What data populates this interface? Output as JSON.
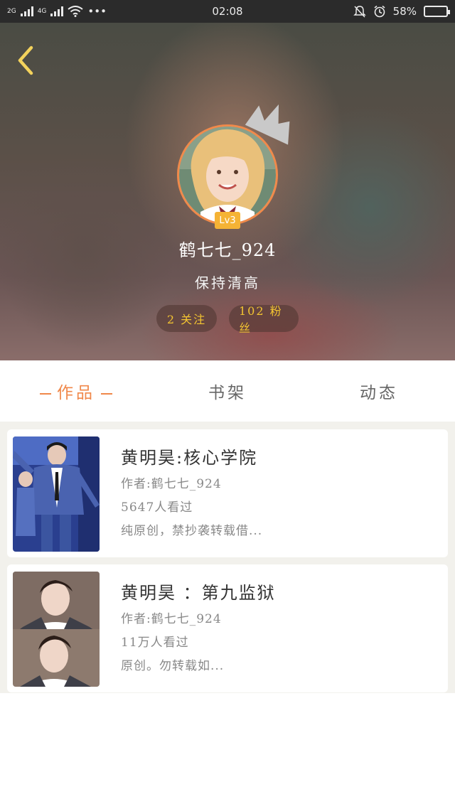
{
  "status_bar": {
    "network_1": "2G",
    "network_2": "4G",
    "dots": "•••",
    "time": "02:08",
    "battery_percent": "58%",
    "battery_level": 0.58,
    "icons": [
      "signal-icon",
      "wifi-icon",
      "silent-bell-icon",
      "alarm-icon",
      "battery-icon"
    ]
  },
  "profile": {
    "username": "鹤七七_924",
    "signature": "保持清高",
    "level": "Lv3",
    "following": "2 关注",
    "fans": "102 粉丝"
  },
  "tabs": [
    {
      "label": "作品",
      "active": true
    },
    {
      "label": "书架",
      "active": false
    },
    {
      "label": "动态",
      "active": false
    }
  ],
  "works": [
    {
      "title": "黄明昊:核心学院",
      "author": "作者:鹤七七_924",
      "views": "5647人看过",
      "description": "纯原创，禁抄袭转载借..."
    },
    {
      "title": "黄明昊 ：第九监狱",
      "author": "作者:鹤七七_924",
      "views": "11万人看过",
      "description": "原创。勿转载如..."
    }
  ],
  "colors": {
    "accent": "#f0884a",
    "level_badge": "#f5b335",
    "stat_text": "#f3c431",
    "battery_fill": "#3fd25a"
  }
}
